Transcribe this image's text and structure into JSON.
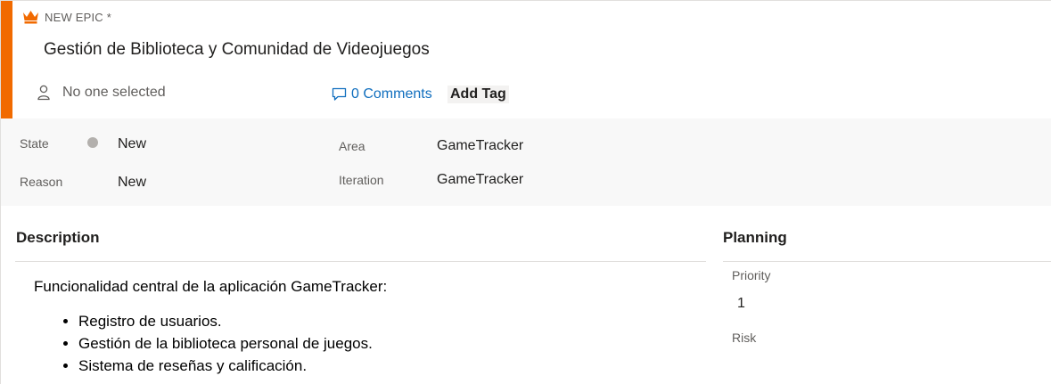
{
  "header": {
    "work_item_type": "NEW EPIC *",
    "title": "Gestión de Biblioteca y Comunidad de Videojuegos",
    "assignee": "No one selected",
    "comments": "0 Comments",
    "add_tag": "Add Tag",
    "accent_color": "#f16a00"
  },
  "fields": {
    "state_label": "State",
    "state_value": "New",
    "reason_label": "Reason",
    "reason_value": "New",
    "area_label": "Area",
    "area_value": "GameTracker",
    "iteration_label": "Iteration",
    "iteration_value": "GameTracker"
  },
  "description": {
    "heading": "Description",
    "intro": "Funcionalidad central de la aplicación GameTracker:",
    "items": [
      "Registro de usuarios.",
      "Gestión de la biblioteca personal de juegos.",
      "Sistema de reseñas y calificación."
    ]
  },
  "planning": {
    "heading": "Planning",
    "priority_label": "Priority",
    "priority_value": "1",
    "risk_label": "Risk"
  },
  "icons": {
    "type_icon": "crown-icon",
    "assignee_icon": "person-icon",
    "comments_icon": "comment-icon"
  }
}
